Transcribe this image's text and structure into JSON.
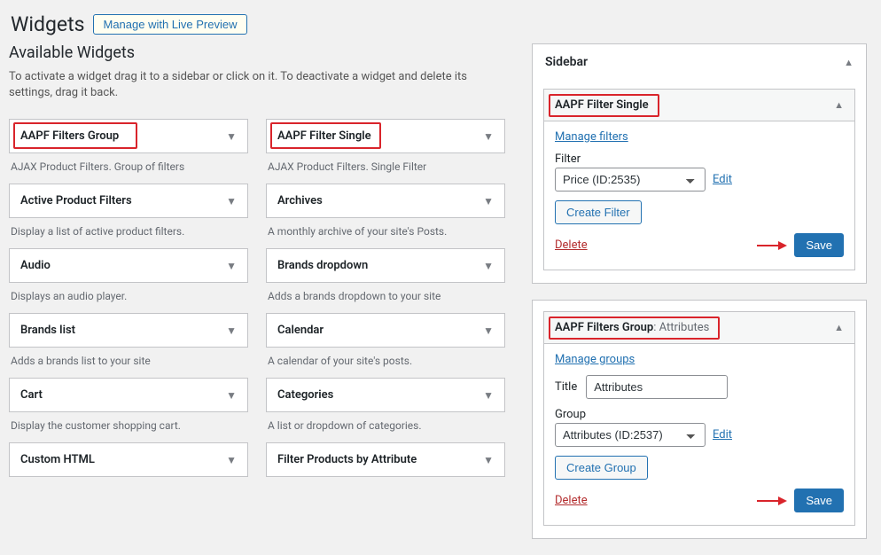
{
  "header": {
    "title": "Widgets",
    "live_preview": "Manage with Live Preview"
  },
  "available": {
    "heading": "Available Widgets",
    "desc": "To activate a widget drag it to a sidebar or click on it. To deactivate a widget and delete its settings, drag it back.",
    "items": [
      {
        "title": "AAPF Filters Group",
        "desc": "AJAX Product Filters. Group of filters",
        "accent": true
      },
      {
        "title": "AAPF Filter Single",
        "desc": "AJAX Product Filters. Single Filter",
        "accent": true
      },
      {
        "title": "Active Product Filters",
        "desc": "Display a list of active product filters."
      },
      {
        "title": "Archives",
        "desc": "A monthly archive of your site's Posts."
      },
      {
        "title": "Audio",
        "desc": "Displays an audio player."
      },
      {
        "title": "Brands dropdown",
        "desc": "Adds a brands dropdown to your site"
      },
      {
        "title": "Brands list",
        "desc": "Adds a brands list to your site"
      },
      {
        "title": "Calendar",
        "desc": "A calendar of your site's posts."
      },
      {
        "title": "Cart",
        "desc": "Display the customer shopping cart."
      },
      {
        "title": "Categories",
        "desc": "A list or dropdown of categories."
      },
      {
        "title": "Custom HTML",
        "desc": ""
      },
      {
        "title": "Filter Products by Attribute",
        "desc": ""
      }
    ]
  },
  "sidebar": {
    "label": "Sidebar",
    "widget1": {
      "name": "AAPF Filter Single",
      "manage": "Manage filters",
      "filter_label": "Filter",
      "filter_value": "Price (ID:2535)",
      "edit": "Edit",
      "create": "Create Filter",
      "delete": "Delete",
      "save": "Save"
    },
    "widget2": {
      "name": "AAPF Filters Group",
      "sub": ": Attributes",
      "manage": "Manage groups",
      "title_label": "Title",
      "title_value": "Attributes",
      "group_label": "Group",
      "group_value": "Attributes (ID:2537)",
      "edit": "Edit",
      "create": "Create Group",
      "delete": "Delete",
      "save": "Save"
    }
  }
}
